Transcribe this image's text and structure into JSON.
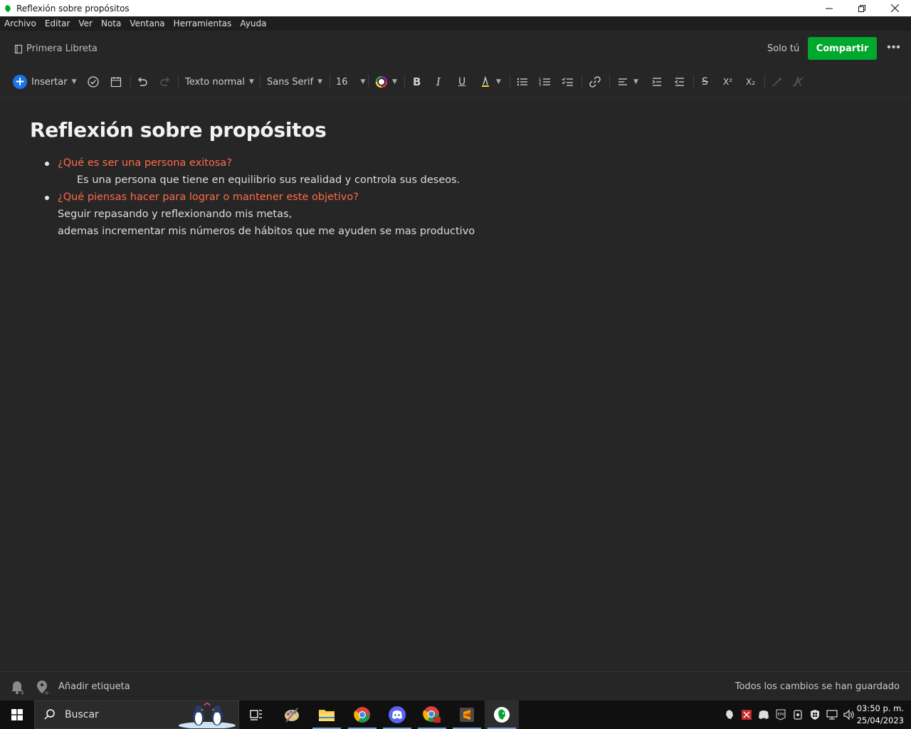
{
  "window": {
    "title": "Reflexión sobre propósitos",
    "controls": [
      "minimize",
      "restore",
      "close"
    ]
  },
  "menubar": {
    "items": [
      "Archivo",
      "Editar",
      "Ver",
      "Nota",
      "Ventana",
      "Herramientas",
      "Ayuda"
    ]
  },
  "header": {
    "notebook": "Primera Libreta",
    "visibility": "Solo tú",
    "share_label": "Compartir",
    "more_icon": "more-horizontal-icon"
  },
  "toolbar": {
    "insert_label": "Insertar",
    "text_style": "Texto normal",
    "font_family": "Sans Serif",
    "font_size": "16",
    "bold": "B",
    "italic": "I",
    "underline": "U",
    "strikethrough": "S",
    "superscript": "X²",
    "subscript": "X₂"
  },
  "note": {
    "title": "Reflexión sobre propósitos",
    "q1": "¿Qué es ser una persona exitosa?",
    "a1": "Es una persona que tiene en equilibrio sus realidad y controla sus deseos.",
    "q2": "¿Qué piensas hacer para lograr o mantener este objetivo?",
    "a2_line1": "Seguir repasando y reflexionando mis metas,",
    "a2_line2": "ademas incrementar mis números de hábitos que me ayuden se mas productivo"
  },
  "footer": {
    "add_tag": "Añadir etiqueta",
    "save_status": "Todos los cambios se han guardado"
  },
  "taskbar": {
    "search_placeholder": "Buscar",
    "time": "03:50 p. m.",
    "date": "25/04/2023"
  },
  "colors": {
    "accent_green": "#00a82d",
    "question_orange": "#ff6b4a",
    "background": "#262626"
  }
}
